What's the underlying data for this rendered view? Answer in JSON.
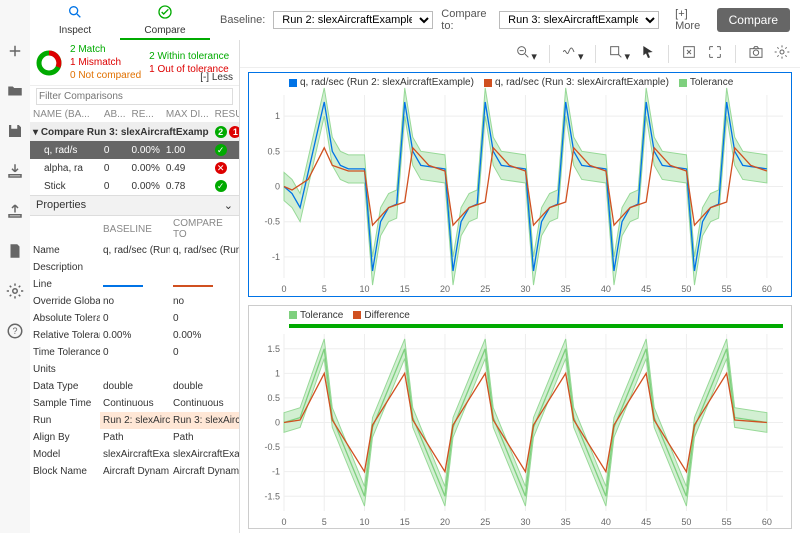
{
  "tabs": {
    "inspect": "Inspect",
    "compare": "Compare"
  },
  "summary": {
    "match": "2 Match",
    "mismatch": "1 Mismatch",
    "notcompared": "0 Not compared",
    "within": "2 Within tolerance",
    "out": "1 Out of tolerance",
    "less": "[-] Less"
  },
  "baseline": {
    "label_b": "Baseline:",
    "sel_b": "Run 2: slexAircraftExample",
    "label_c": "Compare to:",
    "sel_c": "Run 3: slexAircraftExample",
    "more": "[+] More",
    "compare": "Compare"
  },
  "filter_ph": "Filter Comparisons",
  "cols": {
    "name": "NAME (BA...",
    "abs": "AB...",
    "rel": "RE...",
    "max": "MAX DI...",
    "res": "RESULT"
  },
  "group_row": "Compare Run 3: slexAircraftExamp",
  "group_ok": "2",
  "group_err": "1",
  "rows": [
    {
      "name": "q, rad/s",
      "abs": "0",
      "rel": "0.00%",
      "max": "1.00",
      "res": "ok"
    },
    {
      "name": "alpha, ra",
      "abs": "0",
      "rel": "0.00%",
      "max": "0.49",
      "res": "err"
    },
    {
      "name": "Stick",
      "abs": "0",
      "rel": "0.00%",
      "max": "0.78",
      "res": "ok"
    }
  ],
  "props_header": "Properties",
  "props_cols": {
    "b": "BASELINE",
    "c": "COMPARE TO"
  },
  "props": [
    {
      "k": "Name",
      "b": "q, rad/sec (Run",
      "c": "q, rad/sec (Run"
    },
    {
      "k": "Description",
      "b": "",
      "c": ""
    },
    {
      "k": "Line",
      "b": "__LINE_B__",
      "c": "__LINE_C__"
    },
    {
      "k": "Override Global Tole",
      "b": "no",
      "c": "no"
    },
    {
      "k": "Absolute Tolerance",
      "b": "0",
      "c": "0"
    },
    {
      "k": "Relative Tolerance",
      "b": "0.00%",
      "c": "0.00%"
    },
    {
      "k": "Time Tolerance",
      "b": "0",
      "c": "0"
    },
    {
      "k": "Units",
      "b": "",
      "c": ""
    },
    {
      "k": "Data Type",
      "b": "double",
      "c": "double"
    },
    {
      "k": "Sample Time",
      "b": "Continuous",
      "c": "Continuous"
    },
    {
      "k": "Run",
      "b": "Run 2: slexAirc",
      "c": "Run 3: slexAirc",
      "hl": true
    },
    {
      "k": "Align By",
      "b": "Path",
      "c": "Path"
    },
    {
      "k": "Model",
      "b": "slexAircraftExa",
      "c": "slexAircraftExa"
    },
    {
      "k": "Block Name",
      "b": "Aircraft Dynam",
      "c": "Aircraft Dynam"
    }
  ],
  "legend1": {
    "s1": "q, rad/sec (Run 2: slexAircraftExample)",
    "s2": "q, rad/sec (Run 3: slexAircraftExample)",
    "s3": "Tolerance"
  },
  "legend2": {
    "s1": "Tolerance",
    "s2": "Difference"
  },
  "colors": {
    "baseline": "#0073e6",
    "compare": "#d05020",
    "tolerance": "#7ed07e",
    "tol_fill": "#c8ecc8",
    "difference": "#d05020"
  },
  "chart_data": [
    {
      "type": "line",
      "title": "",
      "xlabel": "",
      "ylabel": "",
      "xlim": [
        0,
        62
      ],
      "ylim": [
        -1.3,
        1.3
      ],
      "xticks": [
        0,
        5,
        10,
        15,
        20,
        25,
        30,
        35,
        40,
        45,
        50,
        55,
        60
      ],
      "yticks": [
        -1.0,
        -0.5,
        0,
        0.5,
        1.0
      ],
      "series": [
        {
          "name": "Tolerance band",
          "color": "#c8ecc8",
          "kind": "area"
        },
        {
          "name": "q, rad/sec (Run 2: slexAircraftExample)",
          "color": "#0073e6",
          "x": [
            0,
            1,
            2,
            3,
            5,
            6,
            7,
            8,
            10,
            11,
            12,
            13,
            14,
            15,
            16,
            17,
            20,
            21,
            22,
            23,
            24,
            25,
            26,
            27,
            30,
            31,
            32,
            33,
            34,
            35,
            36,
            37,
            40,
            41,
            42,
            43,
            44,
            45,
            46,
            47,
            50,
            51,
            52,
            53,
            54,
            55,
            56,
            57,
            60
          ],
          "y": [
            0,
            -0.1,
            -0.3,
            0.2,
            1.2,
            0.5,
            0.3,
            0.25,
            0.25,
            -1.2,
            -0.5,
            -0.3,
            -0.25,
            1.2,
            0.5,
            0.3,
            0.25,
            -1.2,
            -0.5,
            -0.3,
            -0.25,
            1.2,
            0.5,
            0.3,
            0.25,
            -1.2,
            -0.5,
            -0.3,
            -0.25,
            1.2,
            0.5,
            0.3,
            0.25,
            -1.2,
            -0.5,
            -0.3,
            -0.25,
            1.2,
            0.5,
            0.3,
            0.25,
            -1.2,
            -0.5,
            -0.3,
            -0.25,
            1.2,
            0.5,
            0.3,
            0.25
          ]
        },
        {
          "name": "q, rad/sec (Run 3: slexAircraftExample)",
          "color": "#d05020",
          "x": [
            0,
            1,
            3,
            5,
            6,
            8,
            10,
            11,
            13,
            15,
            16,
            18,
            20,
            21,
            23,
            25,
            26,
            28,
            30,
            31,
            33,
            35,
            36,
            38,
            40,
            41,
            43,
            45,
            46,
            48,
            50,
            51,
            53,
            55,
            56,
            58,
            60
          ],
          "y": [
            0,
            -0.05,
            0.1,
            0.55,
            0.3,
            0.22,
            0.22,
            -0.55,
            -0.3,
            -0.22,
            0.55,
            0.3,
            0.22,
            -0.55,
            -0.3,
            -0.22,
            0.55,
            0.3,
            0.22,
            -0.55,
            -0.3,
            -0.22,
            0.55,
            0.3,
            0.22,
            -0.55,
            -0.3,
            -0.22,
            0.55,
            0.3,
            0.22,
            -0.55,
            -0.3,
            -0.22,
            0.55,
            0.3,
            0.22
          ]
        }
      ]
    },
    {
      "type": "line",
      "title": "",
      "xlabel": "",
      "ylabel": "",
      "xlim": [
        0,
        62
      ],
      "ylim": [
        -1.8,
        1.8
      ],
      "xticks": [
        0,
        5,
        10,
        15,
        20,
        25,
        30,
        35,
        40,
        45,
        50,
        55,
        60
      ],
      "yticks": [
        -1.5,
        -1.0,
        -0.5,
        0,
        0.5,
        1.0,
        1.5
      ],
      "series": [
        {
          "name": "Tolerance",
          "color": "#7ed07e",
          "x": [
            0,
            2,
            5,
            6,
            10,
            11,
            15,
            16,
            20,
            21,
            25,
            26,
            30,
            31,
            35,
            36,
            40,
            41,
            45,
            46,
            50,
            51,
            55,
            56,
            60
          ],
          "y": [
            0,
            0.1,
            1.5,
            0.1,
            -1.5,
            -0.1,
            1.5,
            0.1,
            -1.5,
            -0.1,
            1.5,
            0.1,
            -1.5,
            -0.1,
            1.5,
            0.1,
            -1.5,
            -0.1,
            1.5,
            0.1,
            -1.5,
            -0.1,
            1.5,
            0.1,
            0
          ]
        },
        {
          "name": "Difference",
          "color": "#d05020",
          "x": [
            0,
            2,
            5,
            6,
            10,
            11,
            15,
            16,
            20,
            21,
            25,
            26,
            30,
            31,
            35,
            36,
            40,
            41,
            45,
            46,
            50,
            51,
            55,
            56,
            60
          ],
          "y": [
            0,
            0.05,
            1.0,
            0.05,
            -1.0,
            -0.05,
            1.0,
            0.05,
            -1.0,
            -0.05,
            1.0,
            0.05,
            -1.0,
            -0.05,
            1.0,
            0.05,
            -1.0,
            -0.05,
            1.0,
            0.05,
            -1.0,
            -0.05,
            1.0,
            0.05,
            0
          ]
        }
      ]
    }
  ]
}
